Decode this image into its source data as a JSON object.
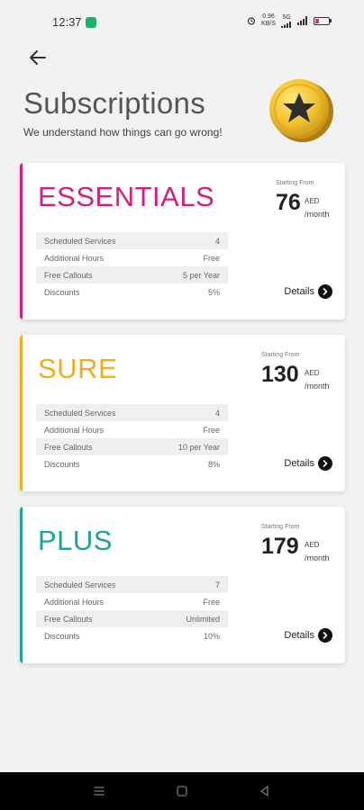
{
  "status_bar": {
    "time": "12:37",
    "net_speed_top": "0.96",
    "net_speed_bottom": "KB/S",
    "signal_label": "5G"
  },
  "header": {
    "title": "Subscriptions",
    "subtitle": "We understand how things can go wrong!"
  },
  "plans": [
    {
      "name": "ESSENTIALS",
      "color": "#d81b7e",
      "starting_from": "Starting From",
      "price": "76",
      "currency": "AED",
      "period": "/month",
      "features": [
        {
          "label": "Scheduled Services",
          "value": "4"
        },
        {
          "label": "Additional Hours",
          "value": "Free"
        },
        {
          "label": "Free Callouts",
          "value": "5 per Year"
        },
        {
          "label": "Discounts",
          "value": "5%"
        }
      ],
      "details_label": "Details"
    },
    {
      "name": "SURE",
      "color": "#f0ad1c",
      "starting_from": "Starting From",
      "price": "130",
      "currency": "AED",
      "period": "/month",
      "features": [
        {
          "label": "Scheduled Services",
          "value": "4"
        },
        {
          "label": "Additional Hours",
          "value": "Free"
        },
        {
          "label": "Free Callouts",
          "value": "10 per Year"
        },
        {
          "label": "Discounts",
          "value": "8%"
        }
      ],
      "details_label": "Details"
    },
    {
      "name": "PLUS",
      "color": "#1ba39c",
      "starting_from": "Starting From",
      "price": "179",
      "currency": "AED",
      "period": "/month",
      "features": [
        {
          "label": "Scheduled Services",
          "value": "7"
        },
        {
          "label": "Additional Hours",
          "value": "Free"
        },
        {
          "label": "Free Callouts",
          "value": "Unlimited"
        },
        {
          "label": "Discounts",
          "value": "10%"
        }
      ],
      "details_label": "Details"
    }
  ],
  "icons": {
    "back": "arrow-left-icon",
    "coin": "star-coin-icon",
    "details": "chevron-right-circle-icon",
    "nav": [
      "menu-icon",
      "home-square-icon",
      "back-triangle-icon"
    ]
  }
}
